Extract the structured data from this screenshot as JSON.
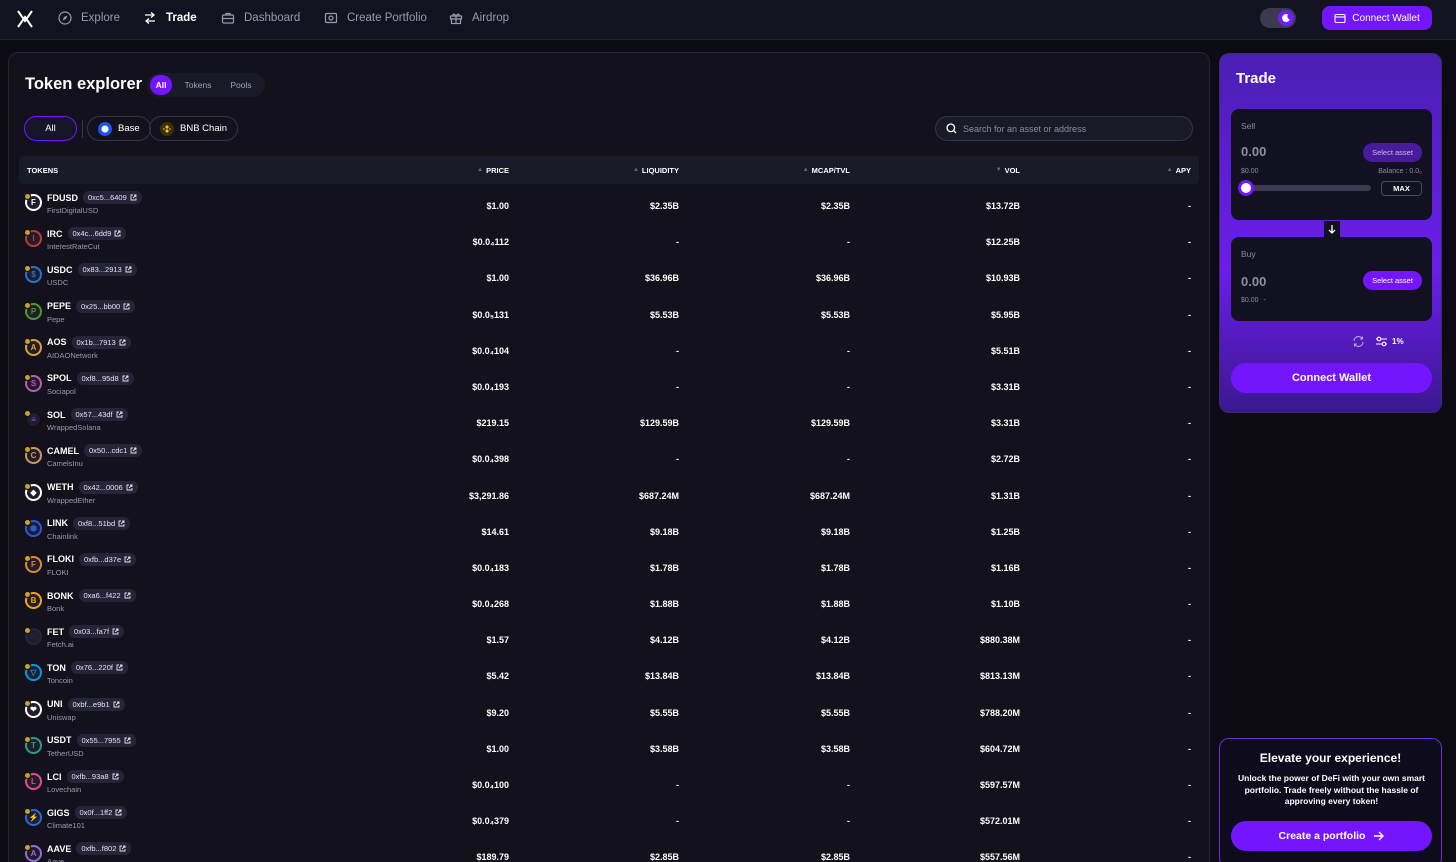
{
  "nav": {
    "items": [
      {
        "label": "Explore",
        "icon": "compass-icon",
        "active": false
      },
      {
        "label": "Trade",
        "icon": "swap-arrows-icon",
        "active": true
      },
      {
        "label": "Dashboard",
        "icon": "briefcase-icon",
        "active": false
      },
      {
        "label": "Create Portfolio",
        "icon": "portfolio-icon",
        "active": false
      },
      {
        "label": "Airdrop",
        "icon": "gift-icon",
        "active": false
      }
    ],
    "connect_wallet": "Connect Wallet"
  },
  "explorer": {
    "title": "Token explorer",
    "segments": [
      "All",
      "Tokens",
      "Pools"
    ],
    "chains": [
      "All",
      "Base",
      "BNB Chain"
    ],
    "search_placeholder": "Search for an asset or address",
    "columns": [
      "TOKENS",
      "PRICE",
      "LIQUIDITY",
      "MCAP/TVL",
      "VOL",
      "APY"
    ],
    "rows": [
      {
        "symbol": "FDUSD",
        "addr": "0xc5...6409",
        "name": "FirstDigitalUSD",
        "price": "$1.00",
        "liquidity": "$2.35B",
        "mcap": "$2.35B",
        "vol": "$13.72B",
        "apy": "-",
        "color": "#ffffff",
        "glyph": "F"
      },
      {
        "symbol": "IRC",
        "addr": "0x4c...6dd9",
        "name": "InterestRateCut",
        "price": "$0.0₄112",
        "liquidity": "-",
        "mcap": "-",
        "vol": "$12.25B",
        "apy": "-",
        "color": "#c0392b",
        "glyph": "I"
      },
      {
        "symbol": "USDC",
        "addr": "0x83...2913",
        "name": "USDC",
        "price": "$1.00",
        "liquidity": "$36.96B",
        "mcap": "$36.96B",
        "vol": "$10.93B",
        "apy": "-",
        "color": "#2775ca",
        "glyph": "$"
      },
      {
        "symbol": "PEPE",
        "addr": "0x25...bb00",
        "name": "Pepe",
        "price": "$0.0₅131",
        "liquidity": "$5.53B",
        "mcap": "$5.53B",
        "vol": "$5.95B",
        "apy": "-",
        "color": "#4c9a2a",
        "glyph": "P"
      },
      {
        "symbol": "AOS",
        "addr": "0x1b...7913",
        "name": "AIDAONetwork",
        "price": "$0.0₄104",
        "liquidity": "-",
        "mcap": "-",
        "vol": "$5.51B",
        "apy": "-",
        "color": "#e0a030",
        "glyph": "A"
      },
      {
        "symbol": "SPOL",
        "addr": "0xf8...95d8",
        "name": "Sociapol",
        "price": "$0.0₄193",
        "liquidity": "-",
        "mcap": "-",
        "vol": "$3.31B",
        "apy": "-",
        "color": "#c05ab0",
        "glyph": "S"
      },
      {
        "symbol": "SOL",
        "addr": "0x57...43df",
        "name": "WrappedSolana",
        "price": "$219.15",
        "liquidity": "$129.59B",
        "mcap": "$129.59B",
        "vol": "$3.31B",
        "apy": "-",
        "color": "#111111",
        "glyph": "≡"
      },
      {
        "symbol": "CAMEL",
        "addr": "0x50...cdc1",
        "name": "CamelsInu",
        "price": "$0.0₄398",
        "liquidity": "-",
        "mcap": "-",
        "vol": "$2.72B",
        "apy": "-",
        "color": "#c89a5a",
        "glyph": "C"
      },
      {
        "symbol": "WETH",
        "addr": "0x42...0006",
        "name": "WrappedEther",
        "price": "$3,291.86",
        "liquidity": "$687.24M",
        "mcap": "$687.24M",
        "vol": "$1.31B",
        "apy": "-",
        "color": "#ffffff",
        "glyph": "◆"
      },
      {
        "symbol": "LINK",
        "addr": "0xf8...51bd",
        "name": "Chainlink",
        "price": "$14.61",
        "liquidity": "$9.18B",
        "mcap": "$9.18B",
        "vol": "$1.25B",
        "apy": "-",
        "color": "#2a5ada",
        "glyph": "⬢"
      },
      {
        "symbol": "FLOKI",
        "addr": "0xfb...d37e",
        "name": "FLOKI",
        "price": "$0.0₄183",
        "liquidity": "$1.78B",
        "mcap": "$1.78B",
        "vol": "$1.16B",
        "apy": "-",
        "color": "#e08a30",
        "glyph": "F"
      },
      {
        "symbol": "BONK",
        "addr": "0xa6...f422",
        "name": "Bonk",
        "price": "$0.0₄268",
        "liquidity": "$1.88B",
        "mcap": "$1.88B",
        "vol": "$1.10B",
        "apy": "-",
        "color": "#f2a900",
        "glyph": "B"
      },
      {
        "symbol": "FET",
        "addr": "0x03...fa7f",
        "name": "Fetch.ai",
        "price": "$1.57",
        "liquidity": "$4.12B",
        "mcap": "$4.12B",
        "vol": "$880.38M",
        "apy": "-",
        "color": "#1c2a3a",
        "glyph": "∷"
      },
      {
        "symbol": "TON",
        "addr": "0x76...220f",
        "name": "Toncoin",
        "price": "$5.42",
        "liquidity": "$13.84B",
        "mcap": "$13.84B",
        "vol": "$813.13M",
        "apy": "-",
        "color": "#0098ea",
        "glyph": "▽"
      },
      {
        "symbol": "UNI",
        "addr": "0xbf...e9b1",
        "name": "Uniswap",
        "price": "$9.20",
        "liquidity": "$5.55B",
        "mcap": "$5.55B",
        "vol": "$788.20M",
        "apy": "-",
        "color": "#ffffff",
        "glyph": "❤"
      },
      {
        "symbol": "USDT",
        "addr": "0x55...7955",
        "name": "TetherUSD",
        "price": "$1.00",
        "liquidity": "$3.58B",
        "mcap": "$3.58B",
        "vol": "$604.72M",
        "apy": "-",
        "color": "#26a17b",
        "glyph": "T"
      },
      {
        "symbol": "LCI",
        "addr": "0xfb...93a8",
        "name": "Lovechain",
        "price": "$0.0₄100",
        "liquidity": "-",
        "mcap": "-",
        "vol": "$597.57M",
        "apy": "-",
        "color": "#e84a8a",
        "glyph": "L"
      },
      {
        "symbol": "GIGS",
        "addr": "0x0f...1ff2",
        "name": "Climate101",
        "price": "$0.0₄379",
        "liquidity": "-",
        "mcap": "-",
        "vol": "$572.01M",
        "apy": "-",
        "color": "#2a6ad8",
        "glyph": "⚡"
      },
      {
        "symbol": "AAVE",
        "addr": "0xfb...f802",
        "name": "Aave",
        "price": "$189.79",
        "liquidity": "$2.85B",
        "mcap": "$2.85B",
        "vol": "$557.56M",
        "apy": "-",
        "color": "#9a6ad8",
        "glyph": "A"
      }
    ]
  },
  "trade": {
    "title": "Trade",
    "sell_label": "Sell",
    "sell_amount": "0.00",
    "sell_usd": "$0.00",
    "balance_label": "Balance :",
    "balance_value": "0.0₀",
    "select_asset": "Select asset",
    "max": "MAX",
    "slider_fraction": 0,
    "buy_label": "Buy",
    "buy_amount": "0.00",
    "buy_usd": "$0.00",
    "buy_usd_suffix": "-",
    "slippage": "1%",
    "connect_wallet": "Connect Wallet"
  },
  "promo": {
    "title": "Elevate your experience!",
    "text": "Unlock the power of DeFi with your own smart portfolio. Trade freely without the hassle of approving every token!",
    "button": "Create a portfolio"
  },
  "colors": {
    "accent": "#7316ff",
    "bg": "#0c0b13",
    "panel": "#12111c"
  }
}
